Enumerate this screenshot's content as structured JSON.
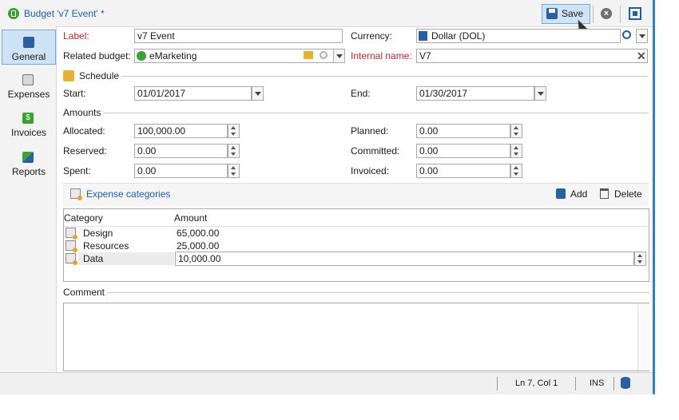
{
  "window": {
    "title": "Budget 'v7 Event' *",
    "save_label": "Save"
  },
  "sidebar": {
    "items": [
      {
        "label": "General",
        "icon": "clipboard-icon",
        "active": true
      },
      {
        "label": "Expenses",
        "icon": "expenses-icon",
        "active": false
      },
      {
        "label": "Invoices",
        "icon": "invoice-icon",
        "active": false
      },
      {
        "label": "Reports",
        "icon": "chart-icon",
        "active": false
      }
    ]
  },
  "form": {
    "label_label": "Label:",
    "label_value": "v7 Event",
    "currency_label": "Currency:",
    "currency_value": "Dollar (DOL)",
    "related_budget_label": "Related budget:",
    "related_budget_value": "eMarketing",
    "internal_name_label": "Internal name:",
    "internal_name_value": "V7"
  },
  "schedule": {
    "title": "Schedule",
    "start_label": "Start:",
    "start_value": "01/01/2017",
    "end_label": "End:",
    "end_value": "01/30/2017"
  },
  "amounts": {
    "title": "Amounts",
    "allocated_label": "Allocated:",
    "allocated_value": "100,000.00",
    "reserved_label": "Reserved:",
    "reserved_value": "0.00",
    "spent_label": "Spent:",
    "spent_value": "0.00",
    "planned_label": "Planned:",
    "planned_value": "0.00",
    "committed_label": "Committed:",
    "committed_value": "0.00",
    "invoiced_label": "Invoiced:",
    "invoiced_value": "0.00"
  },
  "expense_categories": {
    "title": "Expense categories",
    "add_label": "Add",
    "delete_label": "Delete",
    "columns": [
      "Category",
      "Amount"
    ],
    "rows": [
      {
        "category": "Design",
        "amount": "65,000.00"
      },
      {
        "category": "Resources",
        "amount": "25,000.00"
      },
      {
        "category": "Data",
        "amount": "10,000.00"
      }
    ]
  },
  "comment": {
    "title": "Comment",
    "value": ""
  },
  "statusbar": {
    "position": "Ln 7, Col 1",
    "mode": "INS"
  },
  "colors": {
    "accent": "#1f5fa8",
    "required": "#c0262d",
    "selection": "#cfe3f7"
  }
}
